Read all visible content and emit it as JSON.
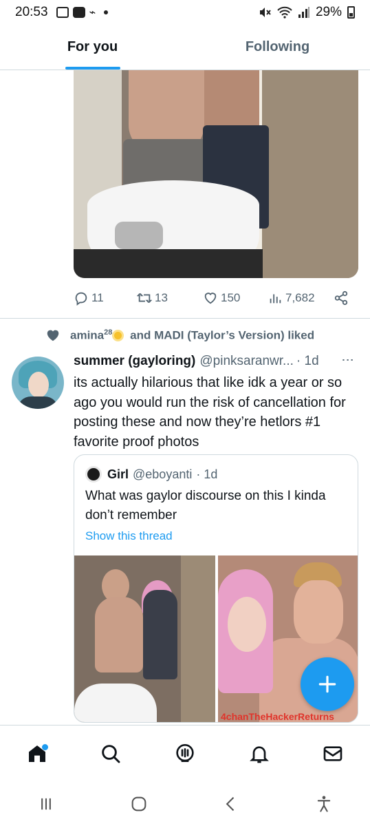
{
  "status_bar": {
    "time": "20:53",
    "battery": "29%"
  },
  "tabs": [
    {
      "label": "For you",
      "active": true
    },
    {
      "label": "Following",
      "active": false
    }
  ],
  "post1": {
    "replies": "11",
    "retweets": "13",
    "likes": "150",
    "views": "7,682"
  },
  "social_context": {
    "liker1": "amina",
    "liker1_sup": "28",
    "text_after": "and MADI (Taylor’s Version) liked"
  },
  "tweet": {
    "display_name": "summer (gayloring)",
    "handle": "@pinksaranwr...",
    "time": "· 1d",
    "text": "its actually hilarious that like idk a year or so ago you would run the risk of cancellation for posting these and now they’re hetlors #1 favorite proof photos"
  },
  "quote": {
    "display_name": "Girl",
    "handle": "@eboyanti",
    "time": "· 1d",
    "text": "What was gaylor discourse on this I kinda don’t remember",
    "link": "Show this thread",
    "image2_caption": "4chanTheHackerReturns"
  },
  "colors": {
    "accent": "#1d9bf0",
    "text_primary": "#0f1419",
    "text_secondary": "#536471",
    "border": "#cfd9de"
  },
  "icons": {
    "reply": "reply-icon",
    "retweet": "retweet-icon",
    "like": "heart-icon",
    "views": "views-icon",
    "share": "share-icon",
    "compose": "plus-icon",
    "home": "home-icon",
    "search": "search-icon",
    "spaces": "spaces-icon",
    "notifications": "bell-icon",
    "messages": "mail-icon"
  }
}
